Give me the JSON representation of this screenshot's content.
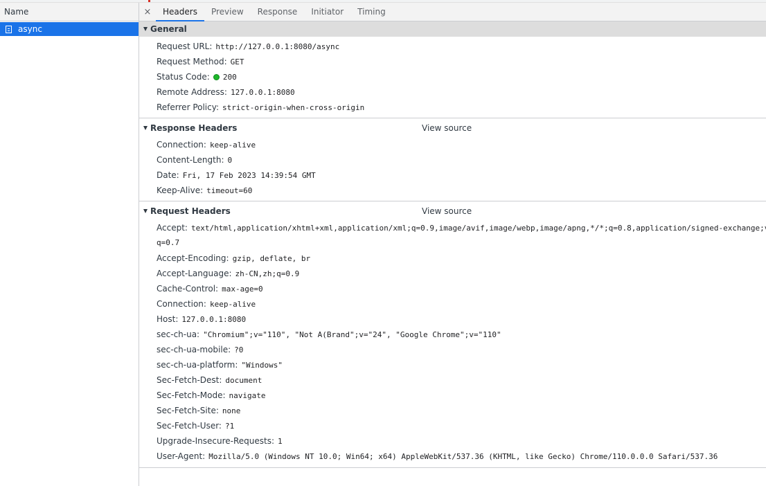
{
  "left_pane": {
    "column_header": "Name",
    "requests": [
      {
        "name": "async",
        "icon": "document-icon"
      }
    ]
  },
  "tabs": {
    "close": "×",
    "items": [
      "Headers",
      "Preview",
      "Response",
      "Initiator",
      "Timing"
    ],
    "active": "Headers"
  },
  "general": {
    "title": "General",
    "rows": [
      {
        "key": "Request URL:",
        "value": "http://127.0.0.1:8080/async"
      },
      {
        "key": "Request Method:",
        "value": "GET"
      },
      {
        "key": "Status Code:",
        "value": "200",
        "status_color": "#1db72b"
      },
      {
        "key": "Remote Address:",
        "value": "127.0.0.1:8080"
      },
      {
        "key": "Referrer Policy:",
        "value": "strict-origin-when-cross-origin"
      }
    ]
  },
  "response_headers": {
    "title": "Response Headers",
    "view_source": "View source",
    "rows": [
      {
        "key": "Connection:",
        "value": "keep-alive"
      },
      {
        "key": "Content-Length:",
        "value": "0"
      },
      {
        "key": "Date:",
        "value": "Fri, 17 Feb 2023 14:39:54 GMT"
      },
      {
        "key": "Keep-Alive:",
        "value": "timeout=60"
      }
    ]
  },
  "request_headers": {
    "title": "Request Headers",
    "view_source": "View source",
    "accept_key": "Accept:",
    "accept_value": "text/html,application/xhtml+xml,application/xml;q=0.9,image/avif,image/webp,image/apng,*/*;q=0.8,application/signed-exchange;v",
    "accept_cont": "q=0.7",
    "rows": [
      {
        "key": "Accept-Encoding:",
        "value": "gzip, deflate, br"
      },
      {
        "key": "Accept-Language:",
        "value": "zh-CN,zh;q=0.9"
      },
      {
        "key": "Cache-Control:",
        "value": "max-age=0"
      },
      {
        "key": "Connection:",
        "value": "keep-alive"
      },
      {
        "key": "Host:",
        "value": "127.0.0.1:8080"
      },
      {
        "key": "sec-ch-ua:",
        "value": "\"Chromium\";v=\"110\", \"Not A(Brand\";v=\"24\", \"Google Chrome\";v=\"110\""
      },
      {
        "key": "sec-ch-ua-mobile:",
        "value": "?0"
      },
      {
        "key": "sec-ch-ua-platform:",
        "value": "\"Windows\""
      },
      {
        "key": "Sec-Fetch-Dest:",
        "value": "document"
      },
      {
        "key": "Sec-Fetch-Mode:",
        "value": "navigate"
      },
      {
        "key": "Sec-Fetch-Site:",
        "value": "none"
      },
      {
        "key": "Sec-Fetch-User:",
        "value": "?1"
      },
      {
        "key": "Upgrade-Insecure-Requests:",
        "value": "1"
      },
      {
        "key": "User-Agent:",
        "value": "Mozilla/5.0 (Windows NT 10.0; Win64; x64) AppleWebKit/537.36 (KHTML, like Gecko) Chrome/110.0.0.0 Safari/537.36"
      }
    ]
  },
  "colors": {
    "selection": "#1a73e8",
    "tab_underline": "#1a73e8",
    "status_ok": "#1db72b"
  }
}
